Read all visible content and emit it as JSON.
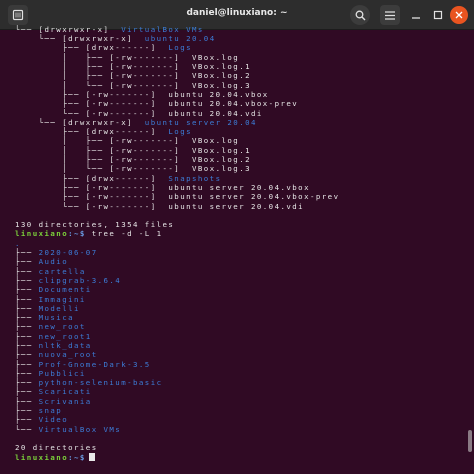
{
  "window": {
    "title": "daniel@linuxiano: ~"
  },
  "tree_lines": [
    {
      "pre": "└── [drwxrwxr-x]  ",
      "name": "VirtualBox VMs",
      "dir": true
    },
    {
      "pre": "    └── [drwxrwxr-x]  ",
      "name": "ubuntu 20.04",
      "dir": true
    },
    {
      "pre": "        ├── [drwx------]  ",
      "name": "Logs",
      "dir": true
    },
    {
      "pre": "        │   ├── [-rw-------]  ",
      "name": "VBox.log",
      "dir": false
    },
    {
      "pre": "        │   ├── [-rw-------]  ",
      "name": "VBox.log.1",
      "dir": false
    },
    {
      "pre": "        │   ├── [-rw-------]  ",
      "name": "VBox.log.2",
      "dir": false
    },
    {
      "pre": "        │   └── [-rw-------]  ",
      "name": "VBox.log.3",
      "dir": false
    },
    {
      "pre": "        ├── [-rw-------]  ",
      "name": "ubuntu 20.04.vbox",
      "dir": false
    },
    {
      "pre": "        ├── [-rw-------]  ",
      "name": "ubuntu 20.04.vbox-prev",
      "dir": false
    },
    {
      "pre": "        └── [-rw-------]  ",
      "name": "ubuntu 20.04.vdi",
      "dir": false
    },
    {
      "pre": "    └── [drwxrwxr-x]  ",
      "name": "ubuntu server 20.04",
      "dir": true
    },
    {
      "pre": "        ├── [drwx------]  ",
      "name": "Logs",
      "dir": true
    },
    {
      "pre": "        │   ├── [-rw-------]  ",
      "name": "VBox.log",
      "dir": false
    },
    {
      "pre": "        │   ├── [-rw-------]  ",
      "name": "VBox.log.1",
      "dir": false
    },
    {
      "pre": "        │   ├── [-rw-------]  ",
      "name": "VBox.log.2",
      "dir": false
    },
    {
      "pre": "        │   └── [-rw-------]  ",
      "name": "VBox.log.3",
      "dir": false
    },
    {
      "pre": "        ├── [drwx------]  ",
      "name": "Snapshots",
      "dir": true
    },
    {
      "pre": "        ├── [-rw-------]  ",
      "name": "ubuntu server 20.04.vbox",
      "dir": false
    },
    {
      "pre": "        ├── [-rw-------]  ",
      "name": "ubuntu server 20.04.vbox-prev",
      "dir": false
    },
    {
      "pre": "        └── [-rw-------]  ",
      "name": "ubuntu server 20.04.vdi",
      "dir": false
    }
  ],
  "summary1": "130 directories, 1354 files",
  "prompt1": {
    "user": "linuxiano",
    "path": ":~$",
    "command": "tree -d -L 1"
  },
  "dot_line": ".",
  "dir_list": [
    "2020-06-07",
    "Audio",
    "cartella",
    "clipgrab-3.6.4",
    "Documenti",
    "Immagini",
    "Modelli",
    "Musica",
    "new_root",
    "new_root1",
    "nltk_data",
    "nuova_root",
    "Prof-Gnome-Dark-3.5",
    "Pubblici",
    "python-selenium-basic",
    "Scaricati",
    "Scrivania",
    "snap",
    "Video",
    "VirtualBox VMs"
  ],
  "summary2": "20 directories",
  "prompt2": {
    "user": "linuxiano",
    "path": ":~$",
    "command": ""
  },
  "colors": {
    "background": "#300a24",
    "dir": "#3c7dd8",
    "prompt_user": "#7bd03a",
    "prompt_path": "#6b9fe8",
    "close": "#e95420"
  },
  "icons": [
    "new-tab-icon",
    "search-icon",
    "hamburger-menu-icon",
    "minimize-icon",
    "maximize-icon",
    "close-icon"
  ]
}
